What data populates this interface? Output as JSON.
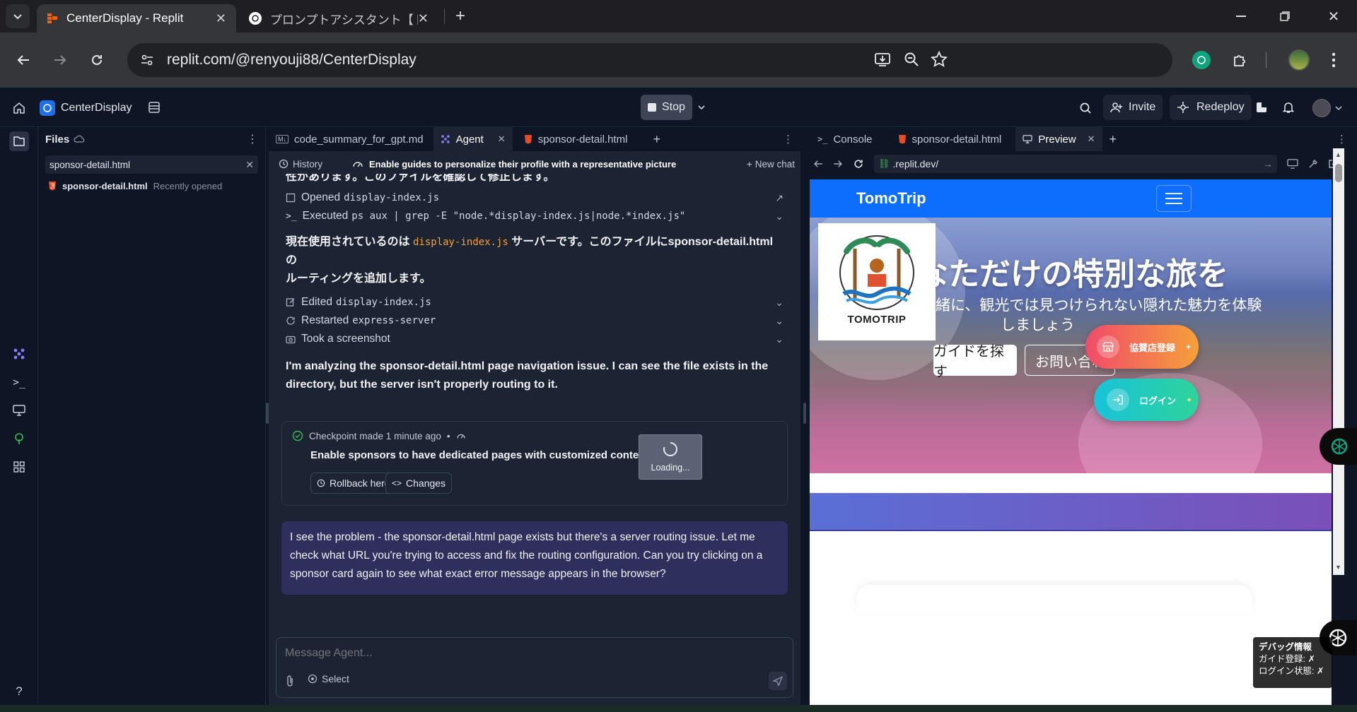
{
  "browser": {
    "tabs": [
      {
        "title": "CenterDisplay - Replit"
      },
      {
        "title": "プロンプトアシスタント【トゥモロープル-"
      }
    ],
    "url": "replit.com/@renyouji88/CenterDisplay"
  },
  "header": {
    "project_name": "CenterDisplay",
    "stop_label": "Stop",
    "invite_label": "Invite",
    "redeploy_label": "Redeploy"
  },
  "files": {
    "title": "Files",
    "open_file": "sponsor-detail.html",
    "recent_name": "sponsor-detail.html",
    "recent_note": "Recently opened"
  },
  "agent": {
    "tabs": [
      "code_summary_for_gpt.md",
      "Agent",
      "sponsor-detail.html"
    ],
    "history_label": "History",
    "current_task": "Enable guides to personalize their profile with a representative picture",
    "new_chat_label": "New chat",
    "line_top": "性があります。このファイルを確認して修正します。",
    "actions": [
      {
        "verb": "Opened",
        "target": "display-index.js"
      },
      {
        "verb": "Executed",
        "target": "ps aux | grep -E \"node.*display-index.js|node.*index.js\""
      }
    ],
    "para1_pre": "現在使用されているのは",
    "para1_code": "display-index.js",
    "para1_post": "サーバーです。このファイルにsponsor-detail.htmlの",
    "para1_line2": "ルーティングを追加します。",
    "actions2": [
      {
        "verb": "Edited",
        "target": "display-index.js"
      },
      {
        "verb": "Restarted",
        "target": "express-server"
      },
      {
        "verb": "Took a screenshot",
        "target": ""
      }
    ],
    "para2": "I'm analyzing the sponsor-detail.html page navigation issue. I can see the file exists in the directory, but the server isn't properly routing to it.",
    "checkpoint": {
      "meta": "Checkpoint made 1 minute ago",
      "title": "Enable sponsors to have dedicated pages with customized content",
      "rollback_label": "Rollback here",
      "changes_label": "Changes",
      "loading_label": "Loading..."
    },
    "reply": "I see the problem - the sponsor-detail.html page exists but there's a server routing issue. Let me check what URL you're trying to access and fix the routing configuration. Can you try clicking on a sponsor card again to see what exact error message appears in the browser?",
    "input_placeholder": "Message Agent...",
    "select_label": "Select"
  },
  "preview": {
    "tabs": [
      "Console",
      "sponsor-detail.html",
      "Preview"
    ],
    "url": ".replit.dev/",
    "site": {
      "brand": "TomoTrip",
      "logo_text": "TOMOTRIP",
      "hero_title": "なただけの特別な旅を",
      "hero_sub1": "緒に、観光では見つけられない隠れた魅力を体験",
      "hero_sub2": "しましょう",
      "btn_find_guide": "ガイドを探す",
      "btn_contact": "お問い合わ",
      "btn_sponsor": "協賛店登録",
      "btn_login": "ログイン",
      "debug_title": "デバッグ情報",
      "debug_line1": "ガイド登録: ✗",
      "debug_line2": "ログイン状態: ✗"
    }
  },
  "colors": {
    "accent_blue": "#0d6efd",
    "agent_bg": "#1c2333",
    "ide_bg": "#0e1525",
    "code_orange": "#f5a13a"
  }
}
